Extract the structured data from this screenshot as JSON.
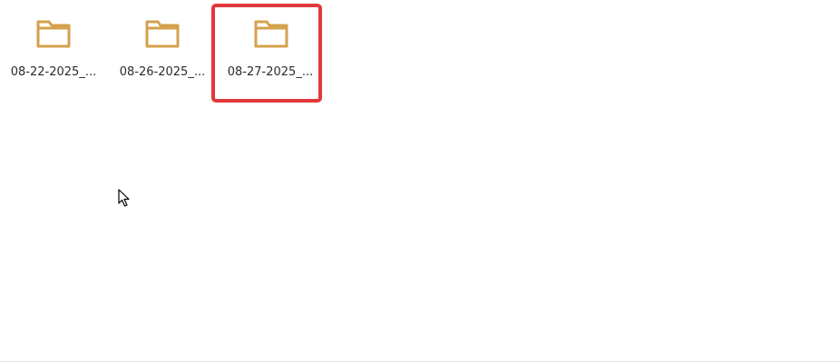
{
  "folders": [
    {
      "label": "08-22-2025_...",
      "icon": "folder-icon",
      "highlighted": false
    },
    {
      "label": "08-26-2025_...",
      "icon": "folder-icon",
      "highlighted": false
    },
    {
      "label": "08-27-2025_...",
      "icon": "folder-icon",
      "highlighted": true
    }
  ],
  "colors": {
    "folder_fill": "#e3b565",
    "folder_stroke": "#d4a24c",
    "highlight_border": "#e0393b",
    "label_text": "#2b2b2b",
    "background": "#ffffff"
  },
  "cursor": {
    "icon": "mouse-pointer-icon"
  }
}
